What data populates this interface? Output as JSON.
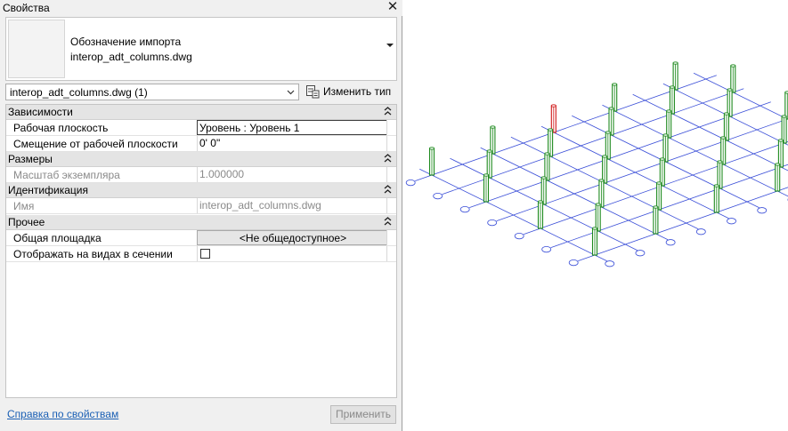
{
  "palette": {
    "title": "Свойства",
    "close_glyph": "✕",
    "type_selector": {
      "line1": "Обозначение импорта",
      "line2": "interop_adt_columns.dwg"
    },
    "instance_filter": "interop_adt_columns.dwg (1)",
    "edit_type_label": "Изменить тип",
    "groups": {
      "constraints": {
        "label": "Зависимости",
        "work_plane_label": "Рабочая плоскость",
        "work_plane_value": "Уровень : Уровень 1",
        "offset_label": "Смещение от рабочей плоскости",
        "offset_value": "0'  0\""
      },
      "dimensions": {
        "label": "Размеры",
        "scale_label": "Масштаб экземпляра",
        "scale_value": "1.000000"
      },
      "identity": {
        "label": "Идентификация",
        "name_label": "Имя",
        "name_value": "interop_adt_columns.dwg"
      },
      "other": {
        "label": "Прочее",
        "shared_site_label": "Общая площадка",
        "shared_site_value": "<Не общедоступное>",
        "show_in_section_label": "Отображать на видах в сечении",
        "show_in_section_checked": false
      }
    },
    "help_link": "Справка по свойствам",
    "apply_button": "Применить"
  },
  "viewport": {
    "description_colors": {
      "grid": "#3b4fd8",
      "column": "#1e8a1e",
      "selected_column": "#d01818",
      "bubble": "#3b4fd8"
    }
  }
}
